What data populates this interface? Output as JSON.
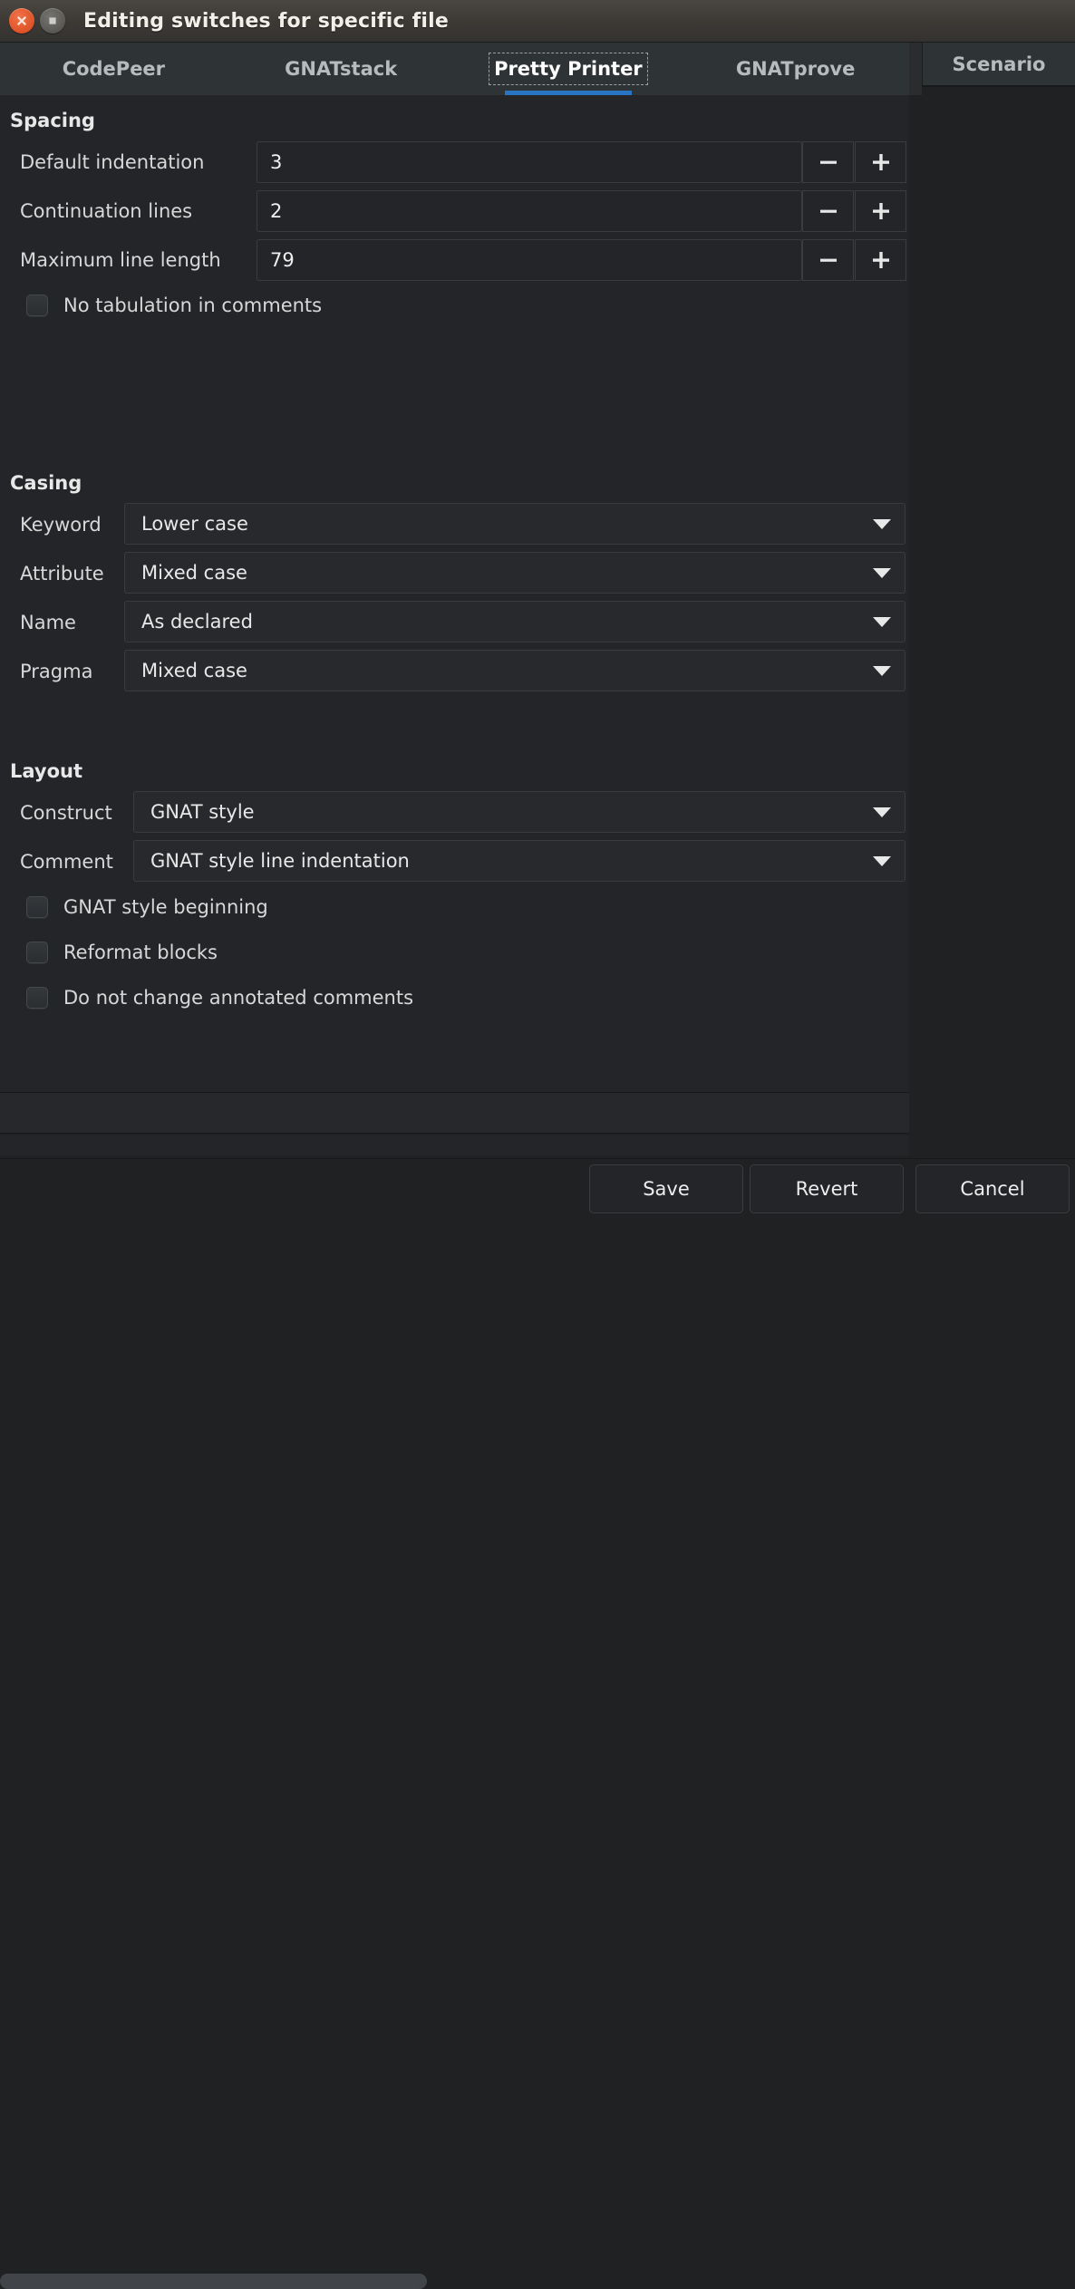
{
  "window": {
    "title": "Editing switches for specific file",
    "close_icon": "close-icon",
    "maximize_icon": "maximize-icon"
  },
  "tabs": [
    {
      "label": "CodePeer",
      "active": false
    },
    {
      "label": "GNATstack",
      "active": false
    },
    {
      "label": "Pretty Printer",
      "active": true
    },
    {
      "label": "GNATprove",
      "active": false
    }
  ],
  "side_tab": {
    "label": "Scenario"
  },
  "sections": {
    "spacing": {
      "title": "Spacing",
      "rows": [
        {
          "label": "Default indentation",
          "value": "3"
        },
        {
          "label": "Continuation lines",
          "value": "2"
        },
        {
          "label": "Maximum line length",
          "value": "79"
        }
      ],
      "checkbox": {
        "label": "No tabulation in comments",
        "checked": false
      }
    },
    "casing": {
      "title": "Casing",
      "rows": [
        {
          "label": "Keyword",
          "value": "Lower case"
        },
        {
          "label": "Attribute",
          "value": "Mixed case"
        },
        {
          "label": "Name",
          "value": "As declared"
        },
        {
          "label": "Pragma",
          "value": "Mixed case"
        }
      ]
    },
    "layout": {
      "title": "Layout",
      "rows": [
        {
          "label": "Construct",
          "value": "GNAT style"
        },
        {
          "label": "Comment",
          "value": "GNAT style line indentation"
        }
      ],
      "checkboxes": [
        {
          "label": "GNAT style beginning",
          "checked": false
        },
        {
          "label": "Reformat blocks",
          "checked": false
        },
        {
          "label": "Do not change annotated comments",
          "checked": false
        }
      ]
    }
  },
  "spinner": {
    "decrement_icon": "minus-icon",
    "increment_icon": "plus-icon"
  },
  "footer": {
    "buttons": [
      {
        "label": "Save"
      },
      {
        "label": "Revert"
      },
      {
        "label": "Cancel"
      }
    ]
  },
  "colors": {
    "accent": "#2a74c4",
    "window_background": "#1f2123",
    "content_background": "#232528",
    "tabstrip_background": "#2e3336",
    "close_button": "#e2562b"
  }
}
